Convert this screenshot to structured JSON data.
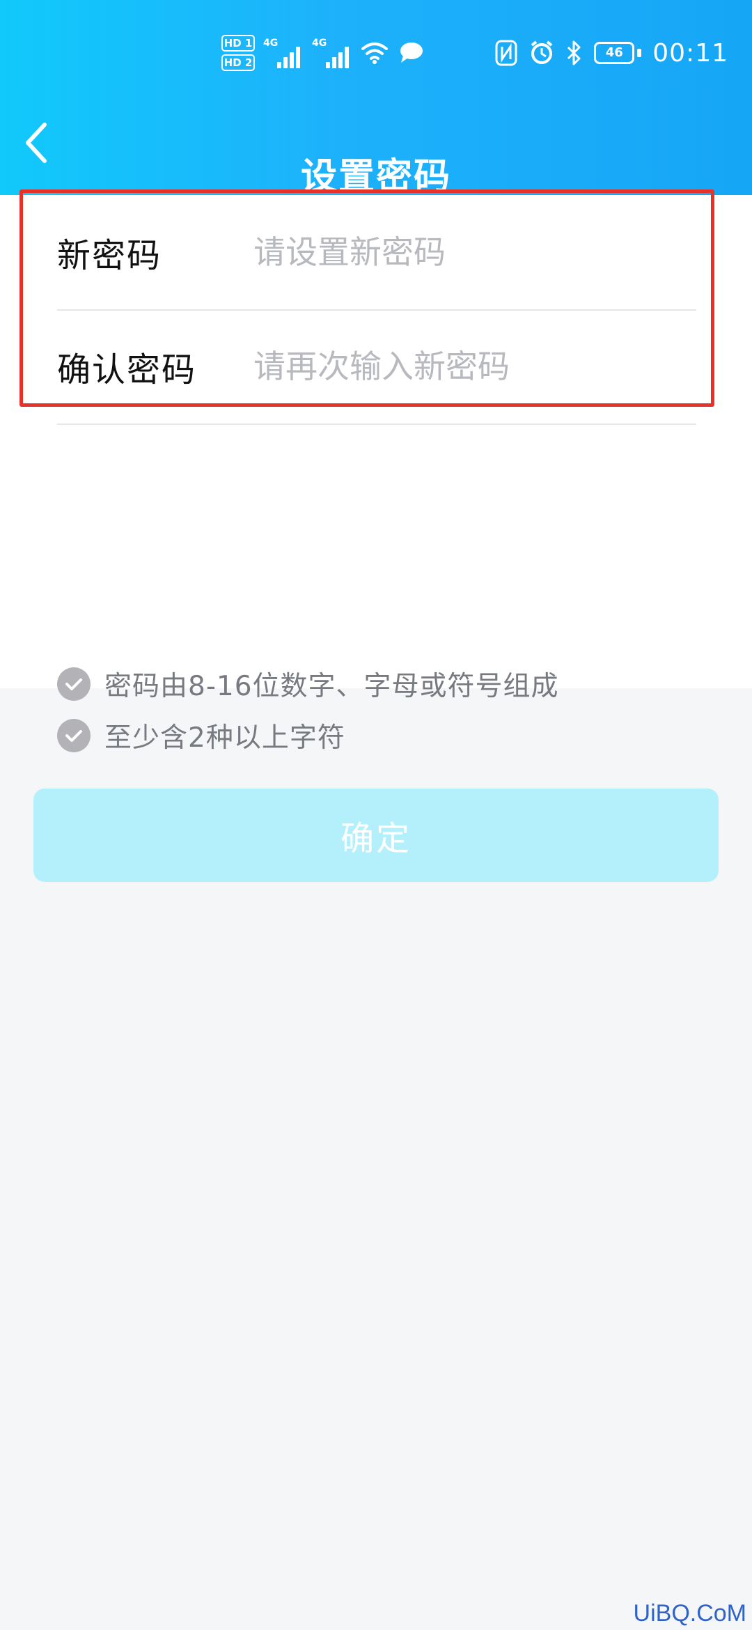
{
  "status_bar": {
    "hd1": "HD 1",
    "hd2": "HD 2",
    "network1": "4G",
    "network2": "4G",
    "battery": "46",
    "time": "00:11",
    "icons": [
      "wifi-icon",
      "chat-icon",
      "nfc-icon",
      "alarm-icon",
      "bluetooth-icon",
      "battery-icon"
    ]
  },
  "header": {
    "title": "设置密码",
    "back_icon": "chevron-left-icon"
  },
  "form": {
    "new_password": {
      "label": "新密码",
      "placeholder": "请设置新密码"
    },
    "confirm_password": {
      "label": "确认密码",
      "placeholder": "请再次输入新密码"
    }
  },
  "rules": [
    {
      "text": "密码由8-16位数字、字母或符号组成",
      "icon": "check-circle-icon"
    },
    {
      "text": "至少含2种以上字符",
      "icon": "check-circle-icon"
    }
  ],
  "confirm_button": {
    "label": "确定"
  },
  "watermark": "UiBQ.CoM",
  "colors": {
    "header_gradient_start": "#11c9fb",
    "header_gradient_end": "#16a6f6",
    "highlight_border": "#e5332a",
    "button_background": "#b4f0fc",
    "page_background": "#f5f6f8"
  }
}
